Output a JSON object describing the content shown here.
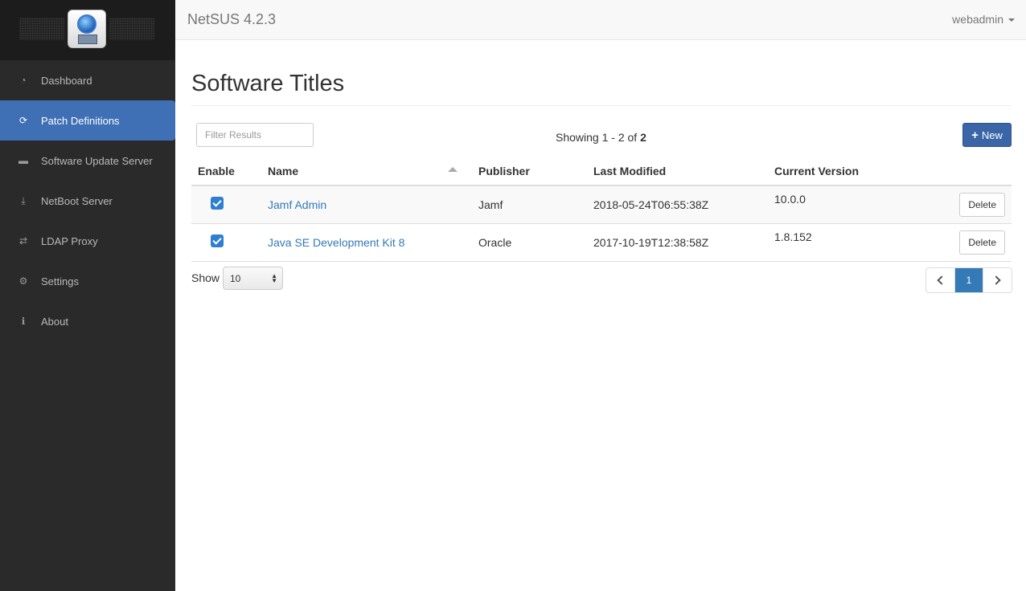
{
  "app": {
    "title": "NetSUS 4.2.3",
    "user": "webadmin"
  },
  "sidebar": {
    "items": [
      {
        "label": "Dashboard",
        "icon": "dashboard-gauge-icon",
        "active": false
      },
      {
        "label": "Patch Definitions",
        "icon": "refresh-icon",
        "active": true
      },
      {
        "label": "Software Update Server",
        "icon": "hard-drive-icon",
        "active": false
      },
      {
        "label": "NetBoot Server",
        "icon": "netboot-download-icon",
        "active": false
      },
      {
        "label": "LDAP Proxy",
        "icon": "exchange-arrows-icon",
        "active": false
      },
      {
        "label": "Settings",
        "icon": "gear-icon",
        "active": false
      },
      {
        "label": "About",
        "icon": "info-icon",
        "active": false
      }
    ]
  },
  "main": {
    "title": "Software Titles",
    "filter_placeholder": "Filter Results",
    "showing_prefix": "Showing 1 - 2 of ",
    "showing_total": "2",
    "new_label": "New",
    "table": {
      "headers": [
        "Enable",
        "Name",
        "Publisher",
        "Last Modified",
        "Current Version"
      ],
      "rows": [
        {
          "enabled": true,
          "name": "Jamf Admin",
          "publisher": "Jamf",
          "modified": "2018-05-24T06:55:38Z",
          "version": "10.0.0",
          "action": "Delete"
        },
        {
          "enabled": true,
          "name": "Java SE Development Kit 8",
          "publisher": "Oracle",
          "modified": "2017-10-19T12:38:58Z",
          "version": "1.8.152",
          "action": "Delete"
        }
      ]
    },
    "show_label": "Show",
    "page_size": "10",
    "pagination": {
      "current": "1"
    }
  },
  "colors": {
    "sidebar_bg": "#2a2a2a",
    "active_nav": "#3f6fb5",
    "primary_button": "#3a66a7",
    "link": "#337ab7"
  }
}
